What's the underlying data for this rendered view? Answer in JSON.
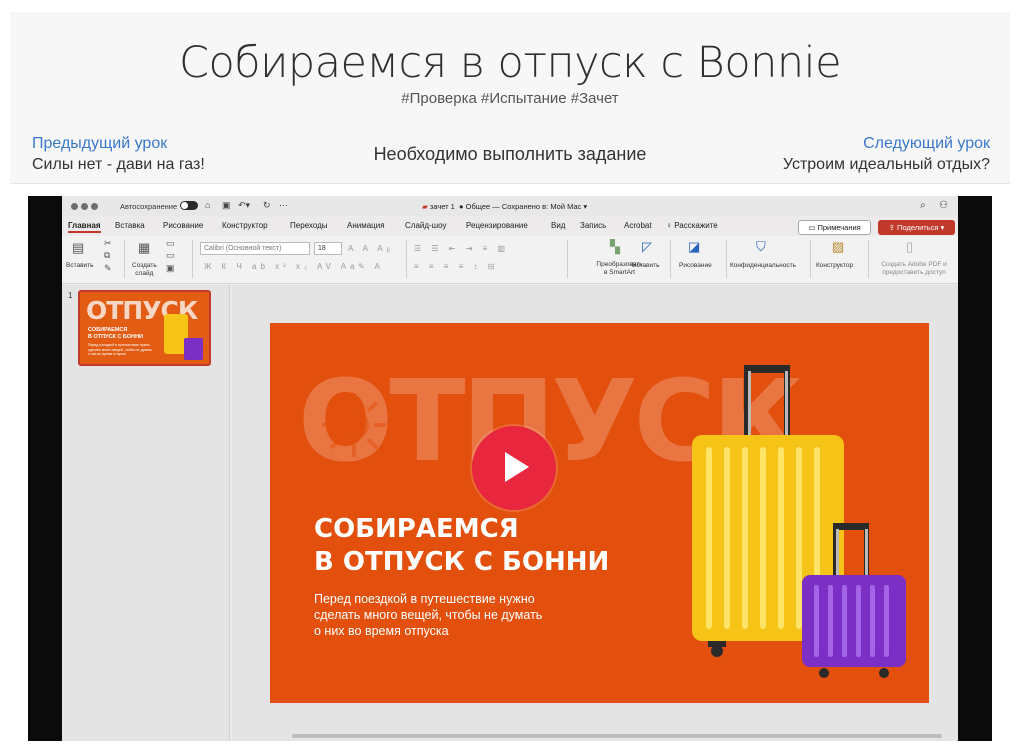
{
  "lesson": {
    "title": "Собираемся в отпуск с Bonnie",
    "tags": "#Проверка #Испытание #Зачет",
    "prev_label": "Предыдущий урок",
    "prev_title": "Силы нет - дави на газ!",
    "center_text": "Необходимо выполнить задание",
    "next_label": "Следующий урок",
    "next_title": "Устроим идеальный отдых?"
  },
  "ppt": {
    "autosave_label": "Автосохранение",
    "doc_name": "зачет 1",
    "doc_status": "Общее — Сохранено в: Мой Mac",
    "tabs": [
      "Главная",
      "Вставка",
      "Рисование",
      "Конструктор",
      "Переходы",
      "Анимация",
      "Слайд-шоу",
      "Рецензирование",
      "Вид",
      "Запись",
      "Acrobat",
      "Расскажите"
    ],
    "comments_label": "Примечания",
    "share_label": "Поделиться",
    "ribbon": {
      "paste": "Вставить",
      "new_slide": "Создать\nслайд",
      "font_name": "Calibri (Основной текст)",
      "font_size": "18",
      "smartart": "Преобразовать\nв SmartArt",
      "insert": "Вставить",
      "drawing": "Рисование",
      "privacy": "Конфиденциальность",
      "designer": "Конструктор",
      "adobe": "Создать Adobe PDF и\nпредоставить доступ"
    },
    "thumbnail": {
      "number": "1",
      "big_word": "ОТПУСК",
      "title": "СОБИРАЕМСЯ\nВ ОТПУСК С БОННИ",
      "body": "Перед поездкой в путешествие нужно\nсделать много вещей, чтобы не думать\nо них во время отпуска"
    },
    "slide": {
      "big_word": "ОТПУСК",
      "title": "СОБИРАЕМСЯ\nВ ОТПУСК С БОННИ",
      "body": "Перед поездкой в путешествие нужно\nсделать много вещей, чтобы не думать\nо них во время отпуска"
    }
  },
  "colors": {
    "slide_bg": "#e3500e",
    "accent_red": "#c0392b",
    "play_button": "#e8263d",
    "suitcase_yellow": "#f6c417",
    "suitcase_purple": "#7b2fc5",
    "link_blue": "#3a78c9"
  },
  "icons": {
    "play": "play-icon",
    "sun": "sun-icon",
    "comments": "comment-icon",
    "share": "share-icon",
    "search": "search-icon"
  }
}
